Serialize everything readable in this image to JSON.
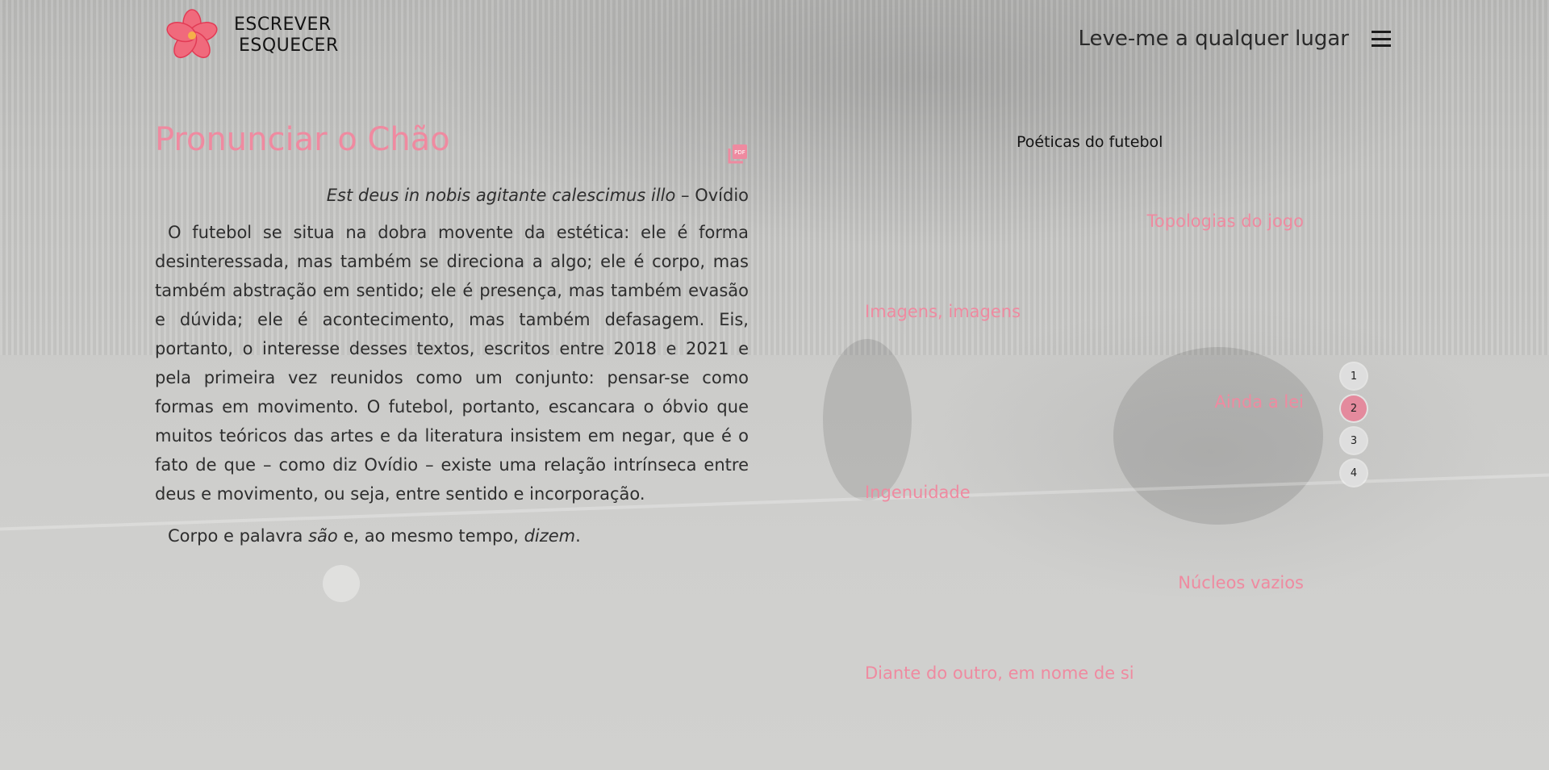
{
  "brand": {
    "line1": "ESCREVER",
    "line2": "ESQUECER"
  },
  "nav": {
    "link": "Leve-me a qualquer lugar"
  },
  "article": {
    "title": "Pronunciar o Chão",
    "epigraph_quote": "Est deus in nobis agitante calescimus illo",
    "epigraph_author": " – Ovídio",
    "paragraph1": "O futebol se situa na dobra movente da estética: ele é forma desinteressada, mas também se direciona a algo; ele é corpo, mas também abstração em sentido; ele é presença, mas também evasão e dúvida; ele é acontecimento, mas também defasagem. Eis, portanto, o interesse desses textos, escritos entre 2018 e 2021 e pela primeira vez reunidos como um conjunto: pensar-se como formas em movimento. O futebol, portanto, escancara o óbvio que muitos teóricos das artes e da literatura insistem em negar, que é o fato de que – como diz Ovídio – existe uma relação intrínseca entre deus e movimento, ou seja, entre sentido e incorporação.",
    "p2_a": "Corpo e palavra ",
    "p2_b": "são",
    "p2_c": " e, ao mesmo tempo, ",
    "p2_d": "dizem",
    "p2_e": "."
  },
  "sidebar": {
    "title": "Poéticas do futebol",
    "chapters": [
      "Topologias do jogo",
      "Imagens, imagens",
      "Ainda a lei",
      "Ingenuidade",
      "Núcleos vazios",
      "Diante do outro, em nome de si"
    ]
  },
  "pagination": {
    "pages": [
      "1",
      "2",
      "3",
      "4"
    ],
    "current": "2"
  },
  "icons": {
    "logo": "hibiscus-flower-icon",
    "menu": "hamburger-menu-icon",
    "pdf": "pdf-icon"
  },
  "colors": {
    "accent": "#ef8aa0",
    "active_page": "#e48a9d",
    "text": "#2e2e2e"
  }
}
